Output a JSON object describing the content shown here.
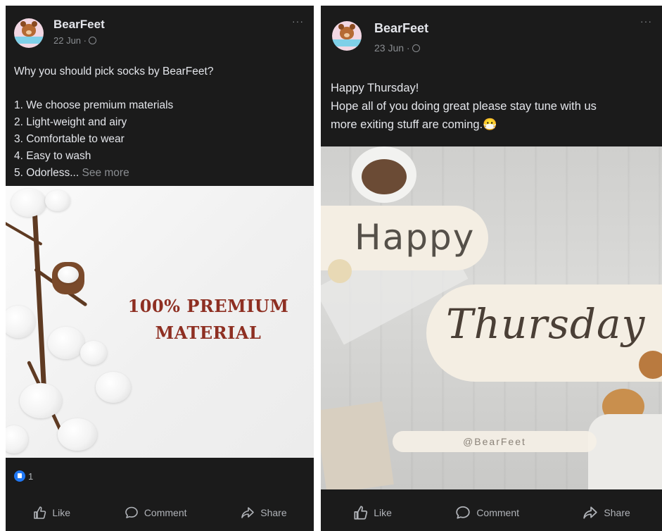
{
  "posts": [
    {
      "author": "BearFeet",
      "date": "22 Jun ·",
      "more_label": "···",
      "text_lines": [
        "Why you should pick socks by BearFeet?",
        "",
        "1. We choose premium materials",
        "2. Light-weight and airy",
        "3. Comfortable to wear",
        "4. Easy to wash"
      ],
      "truncated_line": "5. Odorless...",
      "see_more": "See more",
      "image": {
        "headline_line1": "100% PREMIUM",
        "headline_line2": "MATERIAL"
      },
      "reaction_count": "1",
      "actions": {
        "like": "Like",
        "comment": "Comment",
        "share": "Share"
      }
    },
    {
      "author": "BearFeet",
      "date": "23 Jun ·",
      "more_label": "···",
      "text_lines": [
        "Happy Thursday!",
        "Hope all of you doing great please stay tune with us",
        "more exiting stuff are coming.😷"
      ],
      "image": {
        "word1": "Happy",
        "word2": "Thursday",
        "handle": "@BearFeet"
      },
      "actions": {
        "like": "Like",
        "comment": "Comment",
        "share": "Share"
      }
    }
  ],
  "colors": {
    "post_bg": "#1b1b1b",
    "primary_text": "#e4e6eb",
    "secondary_text": "#8a8d91",
    "headline_red": "#8e2f22",
    "like_blue": "#2078f4"
  },
  "icons": [
    "globe-icon",
    "more-options-icon",
    "like-icon",
    "comment-icon",
    "share-icon",
    "like-reaction-icon"
  ]
}
